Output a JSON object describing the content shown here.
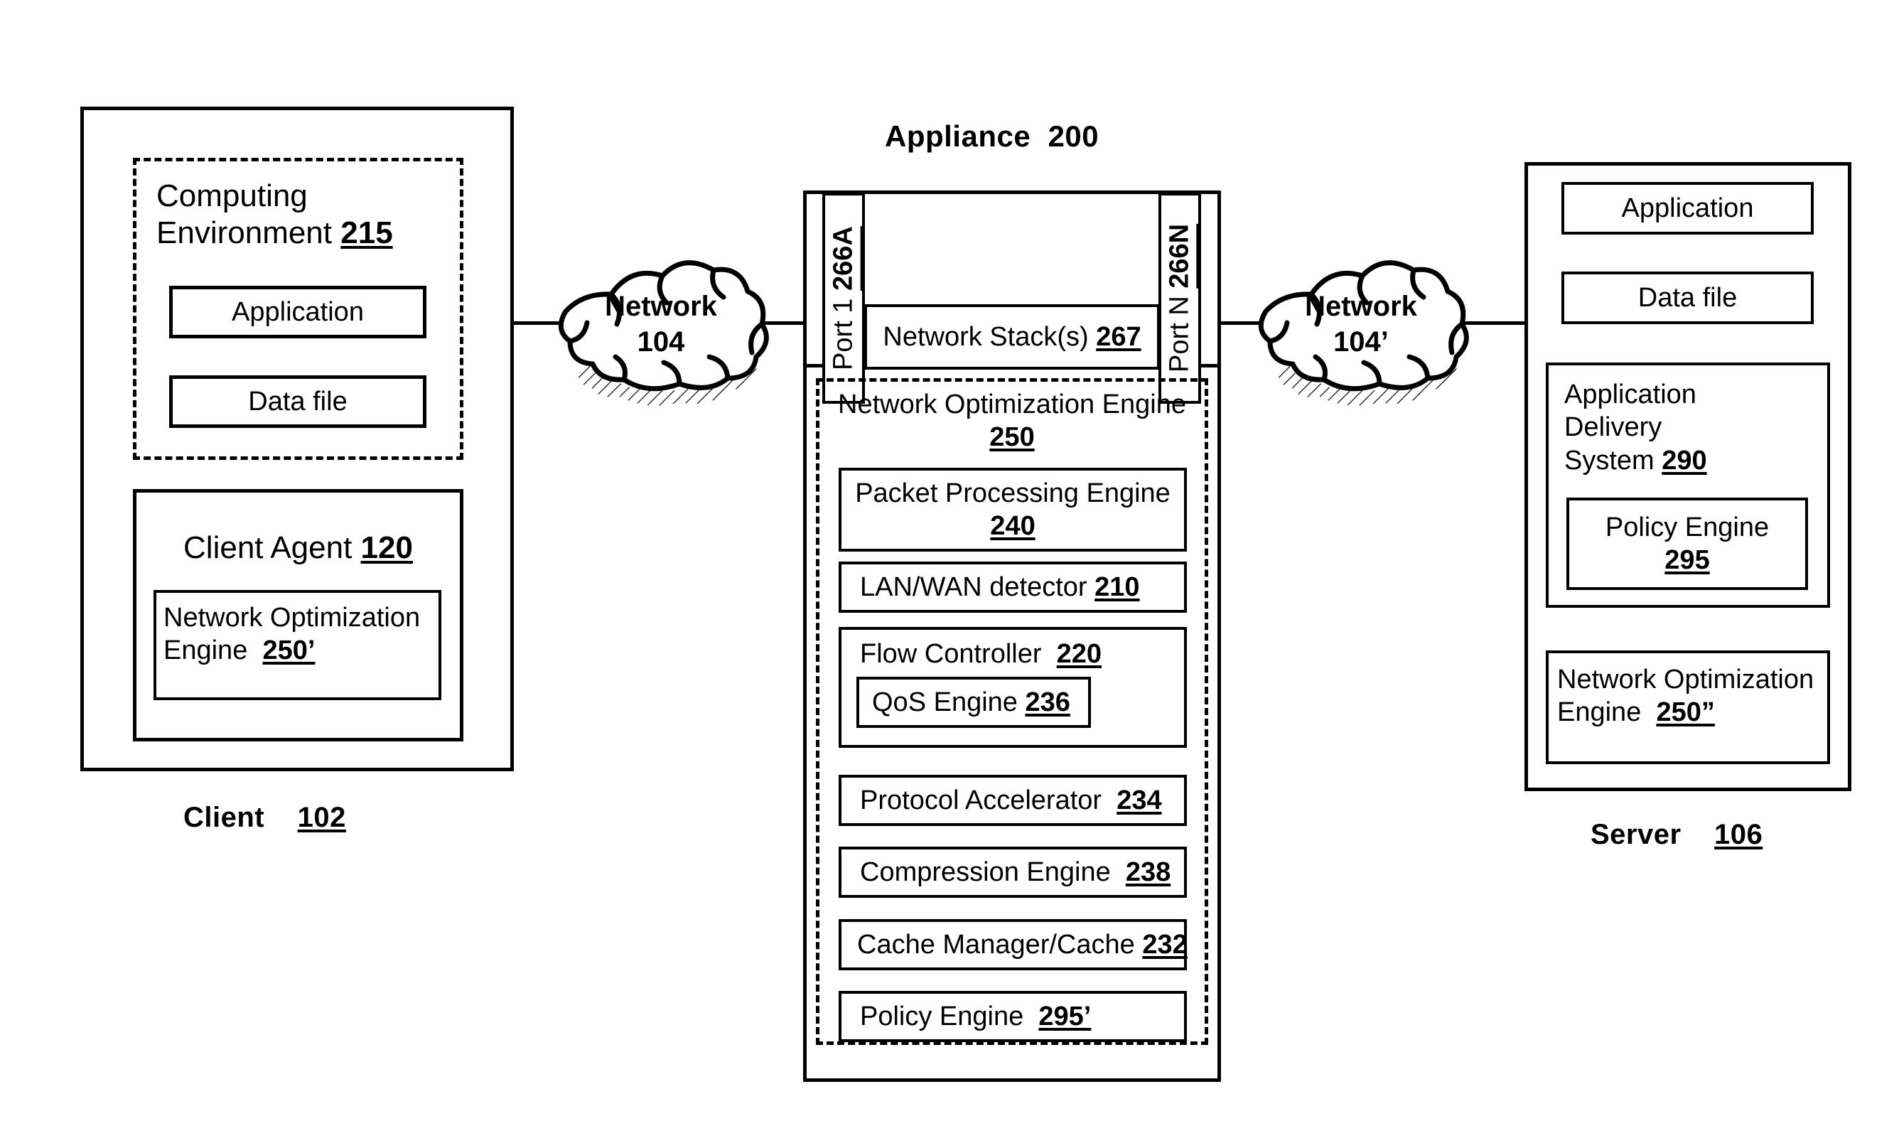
{
  "diagram": {
    "client": {
      "outer_label": "Client",
      "outer_ref": "102",
      "computing_environment": {
        "title": "Computing Environment",
        "ref": "215",
        "items": [
          {
            "label": "Application"
          },
          {
            "label": "Data file"
          }
        ]
      },
      "client_agent": {
        "title": "Client Agent",
        "ref": "120",
        "engine": {
          "label": "Network Optimization Engine",
          "ref": "250’"
        }
      }
    },
    "network_left": {
      "name": "Network",
      "ref": "104",
      "icon": "cloud-icon"
    },
    "network_right": {
      "name": "Network",
      "ref": "104’",
      "icon": "cloud-icon"
    },
    "appliance": {
      "title": "Appliance",
      "ref": "200",
      "port_left": {
        "label": "Port 1",
        "ref": "266A"
      },
      "port_right": {
        "label": "Port N",
        "ref": "266N"
      },
      "network_stack": {
        "label": "Network Stack(s)",
        "ref": "267"
      },
      "optimization_engine": {
        "label": "Network Optimization Engine",
        "ref": "250",
        "modules": [
          {
            "label": "Packet Processing Engine",
            "ref": "240",
            "stacked": true
          },
          {
            "label": "LAN/WAN detector",
            "ref": "210",
            "stacked": false
          },
          {
            "label": "Flow Controller",
            "ref": "220",
            "stacked": false,
            "child": {
              "label": "QoS Engine",
              "ref": "236"
            }
          },
          {
            "label": "Protocol Accelerator",
            "ref": "234",
            "stacked": false
          },
          {
            "label": "Compression Engine",
            "ref": "238",
            "stacked": false
          },
          {
            "label": "Cache Manager/Cache",
            "ref": "232",
            "stacked": false
          },
          {
            "label": "Policy Engine",
            "ref": "295’",
            "stacked": false
          }
        ]
      }
    },
    "server": {
      "outer_label": "Server",
      "outer_ref": "106",
      "items": [
        {
          "label": "Application"
        },
        {
          "label": "Data file"
        }
      ],
      "delivery_system": {
        "label": "Application Delivery System",
        "ref": "290",
        "policy_engine": {
          "label": "Policy Engine",
          "ref": "295"
        }
      },
      "optimization_engine": {
        "label": "Network Optimization Engine",
        "ref": "250”"
      }
    }
  },
  "colors": {
    "stroke": "#000000",
    "background": "#ffffff"
  }
}
